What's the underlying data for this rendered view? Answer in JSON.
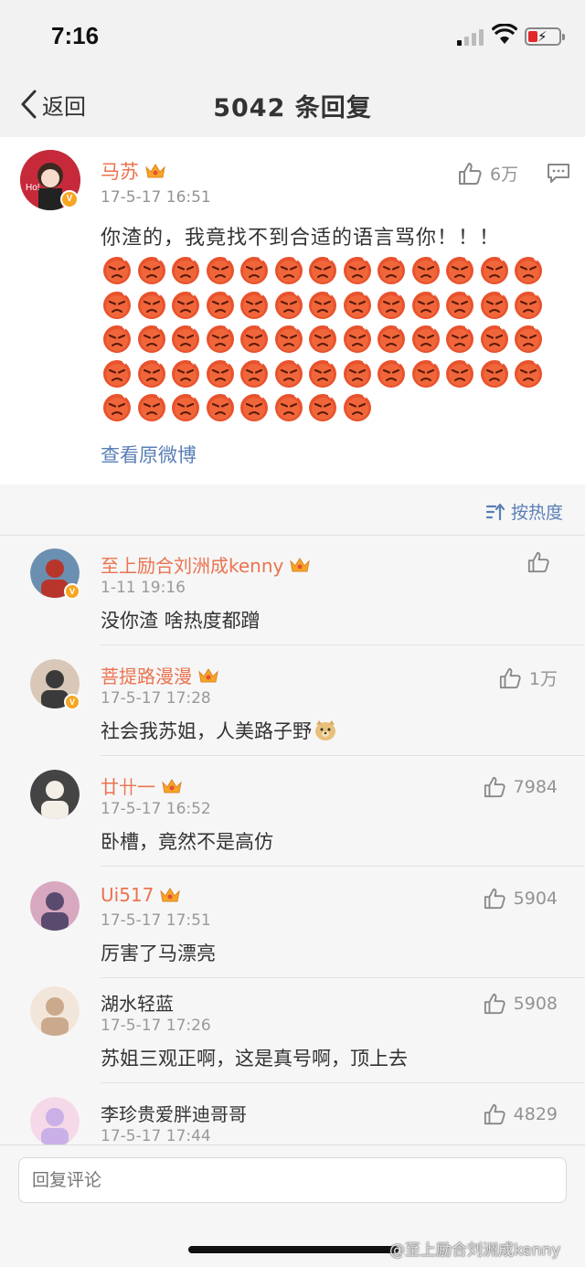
{
  "status_bar": {
    "time": "7:16"
  },
  "nav": {
    "back_label": "返回",
    "title": "5042 条回复"
  },
  "post": {
    "author": "马苏",
    "timestamp": "17-5-17 16:51",
    "likes": "6万",
    "text": "你渣的，我竟找不到合适的语言骂你！！！",
    "emoji_name": "angry-face",
    "emoji_rows": [
      13,
      13,
      13,
      13,
      8
    ],
    "view_original": "查看原微博"
  },
  "sort": {
    "label": "按热度"
  },
  "comments": [
    {
      "name": "至上励合刘洲成kenny",
      "time": "1-11 19:16",
      "text": "没你渣 啥热度都蹭",
      "likes": "",
      "name_color": "#eb7350",
      "vip": true,
      "verified": true,
      "avatar_colors": [
        "#b8352c",
        "#6b8fb0"
      ]
    },
    {
      "name": "菩提路漫漫",
      "time": "17-5-17 17:28",
      "text": "社会我苏姐，人美路子野",
      "text_emoji": "doge-icon",
      "likes": "1万",
      "name_color": "#eb7350",
      "vip": true,
      "verified": true,
      "avatar_colors": [
        "#3a3a3a",
        "#d9c7b8"
      ]
    },
    {
      "name": "廿卄一",
      "time": "17-5-17 16:52",
      "text": "卧槽，竟然不是高仿",
      "likes": "7984",
      "name_color": "#eb7350",
      "vip": true,
      "verified": false,
      "avatar_colors": [
        "#f3efe6",
        "#444444"
      ]
    },
    {
      "name": "Ui517",
      "time": "17-5-17 17:51",
      "text": "厉害了马漂亮",
      "likes": "5904",
      "name_color": "#eb7350",
      "vip": true,
      "verified": false,
      "avatar_colors": [
        "#5a4a6e",
        "#d8a8c0"
      ]
    },
    {
      "name": "湖水轻蓝",
      "time": "17-5-17 17:26",
      "text": "苏姐三观正啊，这是真号啊，顶上去",
      "likes": "5908",
      "name_color": "#333333",
      "vip": false,
      "verified": false,
      "avatar_colors": [
        "#caa98c",
        "#f2e6da"
      ]
    },
    {
      "name": "李珍贵爱胖迪哥哥",
      "time": "17-5-17 17:44",
      "text": "",
      "likes": "4829",
      "name_color": "#333333",
      "vip": false,
      "verified": false,
      "avatar_colors": [
        "#c9b0e6",
        "#f5d9e8"
      ]
    }
  ],
  "reply": {
    "placeholder": "回复评论"
  },
  "watermark": "@至上励合刘洲成kenny",
  "colors": {
    "username_vip": "#eb7350",
    "link": "#5a7fb5",
    "meta_gray": "#939393"
  }
}
